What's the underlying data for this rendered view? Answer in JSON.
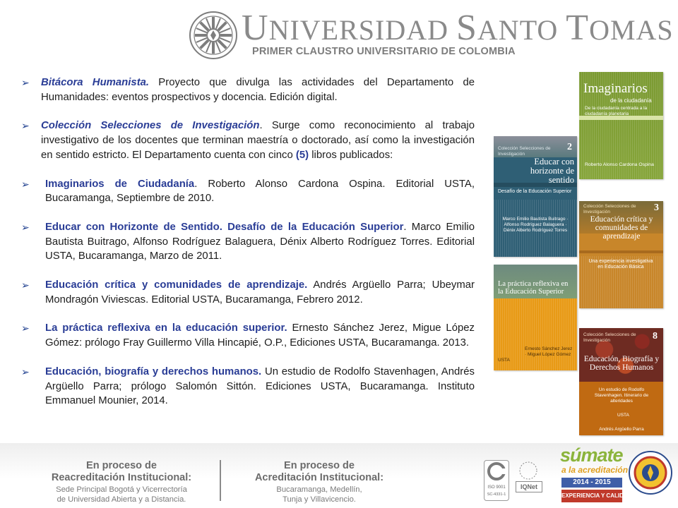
{
  "header": {
    "title_parts": [
      "U",
      "NIVERSIDAD ",
      "S",
      "ANTO ",
      "T",
      "OMAS"
    ],
    "subtitle": "PRIMER CLAUSTRO UNIVERSITARIO DE COLOMBIA"
  },
  "entries": [
    {
      "title": "Bitácora Humanista.",
      "text": " Proyecto que divulga las actividades del Departamento de Humanidades: eventos prospectivos y docencia. Edición digital."
    },
    {
      "title": "Colección Selecciones de Investigación",
      "text_before": ". Surge como reconocimiento al trabajo investigativo de los docentes que terminan maestría o doctorado, así como la investigación en sentido estricto. El Departamento cuenta con cinco ",
      "highlight": "(5)",
      "text_after": " libros publicados:"
    },
    {
      "title": "Imaginarios de Ciudadanía",
      "text": ". Roberto Alonso Cardona Ospina. Editorial USTA, Bucaramanga, Septiembre de 2010."
    },
    {
      "title": "Educar con Horizonte de Sentido. Desafío de la Educación Superior",
      "text": ". Marco Emilio Bautista Buitrago, Alfonso Rodríguez Balaguera, Dénix Alberto Rodríguez Torres. Editorial USTA, Bucaramanga, Marzo de 2011."
    },
    {
      "title": "Educación crítica y comunidades de aprendizaje.",
      "text": " Andrés Argüello Parra; Ubeymar Mondragón Viviescas. Editorial USTA, Bucaramanga, Febrero 2012."
    },
    {
      "title": "La práctica reflexiva en la educación superior.",
      "text": " Ernesto Sánchez Jerez, Migue López Gómez: prólogo Fray Guillermo Villa Hincapié, O.P., Ediciones USTA, Bucaramanga. 2013."
    },
    {
      "title": "Educación, biografía y derechos humanos.",
      "text": " Un estudio de Rodolfo Stavenhagen, Andrés Argüello Parra; prólogo Salomón Sittón. Ediciones USTA, Bucaramanga. Instituto Emmanuel Mounier, 2014."
    }
  ],
  "bullet_glyph": "➢",
  "covers": {
    "imaginarios": {
      "title": "Imaginarios",
      "sub": "de la ciudadanía",
      "tagline": "De la ciudadanía centrada a la ciudadanía planetaria",
      "author": "Roberto Alonso Cardona Ospina"
    },
    "educar": {
      "series": "Colección Selecciones de Investigación",
      "title": "Educar con horizonte de sentido",
      "sub": "Desafío de la Educación Superior",
      "number": "2",
      "authors": "Marco Emilio Bautista Buitrago · Alfonso Rodríguez Balaguera · Dénix Alberto Rodríguez Torres"
    },
    "critica": {
      "series": "Colección Selecciones de Investigación",
      "title": "Educación crítica y comunidades de aprendizaje",
      "sub": "Una experiencia investigativa en Educación Básica",
      "number": "3"
    },
    "practica": {
      "title": "La práctica reflexiva en la Educación Superior",
      "authors": "Ernesto Sánchez Jerez · Miguel López Gómez",
      "imprint": "USTA"
    },
    "biografia": {
      "series": "Colección Selecciones de Investigación",
      "title": "Educación, Biografía y Derechos Humanos",
      "sub": "Un estudio de Rodolfo Stavenhagen. Itinerario de alteridades",
      "number": "8",
      "author": "Andrés Argüello Parra",
      "imprint": "USTA"
    }
  },
  "footer": {
    "left_head": [
      "En proceso de",
      "Reacreditación Institucional:"
    ],
    "left_sub": [
      "Sede Principal Bogotá y Vicerrectoría",
      "de Universidad Abierta y a Distancia."
    ],
    "mid_head": [
      "En proceso de",
      "Acreditación Institucional:"
    ],
    "mid_sub": [
      "Bucaramanga, Medellín,",
      "Tunja y Villavicencio."
    ],
    "iso_text": "ISO 9001",
    "iso_code": "SC-4331-1",
    "iqnet": "IQNet",
    "sumate": {
      "line1": "súmate",
      "line2": "a la acreditación",
      "years": "2014 - 2015",
      "line3": "EXPERIENCIA Y CALIDAD"
    }
  },
  "colors": {
    "accent": "#2a3d96",
    "bullet": "#1f3f8f",
    "text": "#1d1d1d",
    "header_gray": "#8a8a8a"
  }
}
